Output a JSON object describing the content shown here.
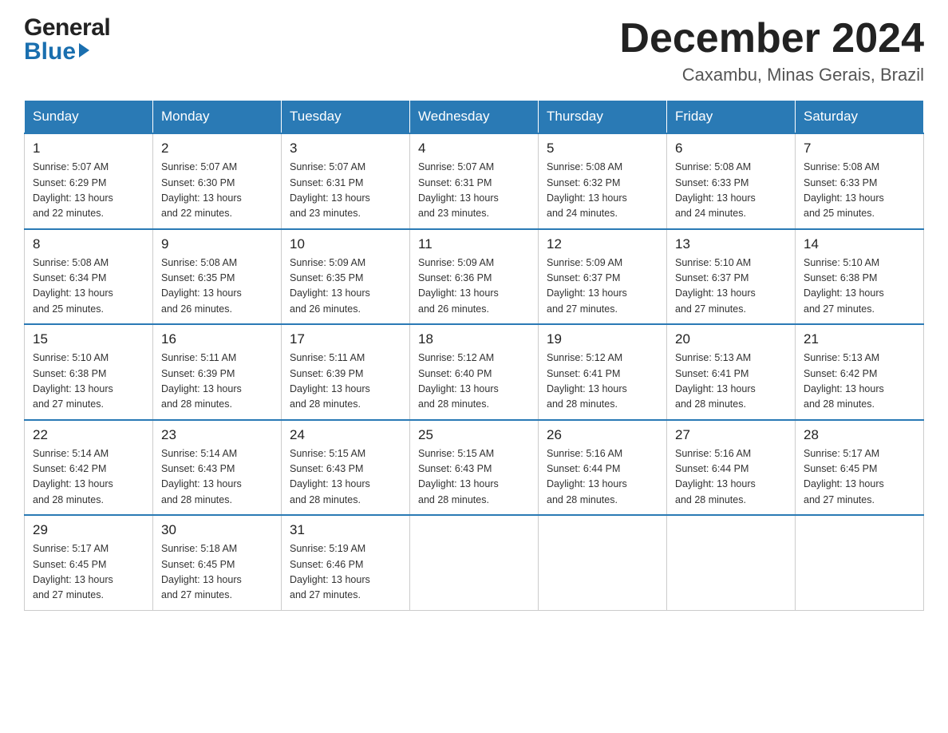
{
  "header": {
    "logo_general": "General",
    "logo_blue": "Blue",
    "month_title": "December 2024",
    "subtitle": "Caxambu, Minas Gerais, Brazil"
  },
  "days_of_week": [
    "Sunday",
    "Monday",
    "Tuesday",
    "Wednesday",
    "Thursday",
    "Friday",
    "Saturday"
  ],
  "weeks": [
    [
      {
        "day": "1",
        "sunrise": "5:07 AM",
        "sunset": "6:29 PM",
        "daylight": "13 hours and 22 minutes."
      },
      {
        "day": "2",
        "sunrise": "5:07 AM",
        "sunset": "6:30 PM",
        "daylight": "13 hours and 22 minutes."
      },
      {
        "day": "3",
        "sunrise": "5:07 AM",
        "sunset": "6:31 PM",
        "daylight": "13 hours and 23 minutes."
      },
      {
        "day": "4",
        "sunrise": "5:07 AM",
        "sunset": "6:31 PM",
        "daylight": "13 hours and 23 minutes."
      },
      {
        "day": "5",
        "sunrise": "5:08 AM",
        "sunset": "6:32 PM",
        "daylight": "13 hours and 24 minutes."
      },
      {
        "day": "6",
        "sunrise": "5:08 AM",
        "sunset": "6:33 PM",
        "daylight": "13 hours and 24 minutes."
      },
      {
        "day": "7",
        "sunrise": "5:08 AM",
        "sunset": "6:33 PM",
        "daylight": "13 hours and 25 minutes."
      }
    ],
    [
      {
        "day": "8",
        "sunrise": "5:08 AM",
        "sunset": "6:34 PM",
        "daylight": "13 hours and 25 minutes."
      },
      {
        "day": "9",
        "sunrise": "5:08 AM",
        "sunset": "6:35 PM",
        "daylight": "13 hours and 26 minutes."
      },
      {
        "day": "10",
        "sunrise": "5:09 AM",
        "sunset": "6:35 PM",
        "daylight": "13 hours and 26 minutes."
      },
      {
        "day": "11",
        "sunrise": "5:09 AM",
        "sunset": "6:36 PM",
        "daylight": "13 hours and 26 minutes."
      },
      {
        "day": "12",
        "sunrise": "5:09 AM",
        "sunset": "6:37 PM",
        "daylight": "13 hours and 27 minutes."
      },
      {
        "day": "13",
        "sunrise": "5:10 AM",
        "sunset": "6:37 PM",
        "daylight": "13 hours and 27 minutes."
      },
      {
        "day": "14",
        "sunrise": "5:10 AM",
        "sunset": "6:38 PM",
        "daylight": "13 hours and 27 minutes."
      }
    ],
    [
      {
        "day": "15",
        "sunrise": "5:10 AM",
        "sunset": "6:38 PM",
        "daylight": "13 hours and 27 minutes."
      },
      {
        "day": "16",
        "sunrise": "5:11 AM",
        "sunset": "6:39 PM",
        "daylight": "13 hours and 28 minutes."
      },
      {
        "day": "17",
        "sunrise": "5:11 AM",
        "sunset": "6:39 PM",
        "daylight": "13 hours and 28 minutes."
      },
      {
        "day": "18",
        "sunrise": "5:12 AM",
        "sunset": "6:40 PM",
        "daylight": "13 hours and 28 minutes."
      },
      {
        "day": "19",
        "sunrise": "5:12 AM",
        "sunset": "6:41 PM",
        "daylight": "13 hours and 28 minutes."
      },
      {
        "day": "20",
        "sunrise": "5:13 AM",
        "sunset": "6:41 PM",
        "daylight": "13 hours and 28 minutes."
      },
      {
        "day": "21",
        "sunrise": "5:13 AM",
        "sunset": "6:42 PM",
        "daylight": "13 hours and 28 minutes."
      }
    ],
    [
      {
        "day": "22",
        "sunrise": "5:14 AM",
        "sunset": "6:42 PM",
        "daylight": "13 hours and 28 minutes."
      },
      {
        "day": "23",
        "sunrise": "5:14 AM",
        "sunset": "6:43 PM",
        "daylight": "13 hours and 28 minutes."
      },
      {
        "day": "24",
        "sunrise": "5:15 AM",
        "sunset": "6:43 PM",
        "daylight": "13 hours and 28 minutes."
      },
      {
        "day": "25",
        "sunrise": "5:15 AM",
        "sunset": "6:43 PM",
        "daylight": "13 hours and 28 minutes."
      },
      {
        "day": "26",
        "sunrise": "5:16 AM",
        "sunset": "6:44 PM",
        "daylight": "13 hours and 28 minutes."
      },
      {
        "day": "27",
        "sunrise": "5:16 AM",
        "sunset": "6:44 PM",
        "daylight": "13 hours and 28 minutes."
      },
      {
        "day": "28",
        "sunrise": "5:17 AM",
        "sunset": "6:45 PM",
        "daylight": "13 hours and 27 minutes."
      }
    ],
    [
      {
        "day": "29",
        "sunrise": "5:17 AM",
        "sunset": "6:45 PM",
        "daylight": "13 hours and 27 minutes."
      },
      {
        "day": "30",
        "sunrise": "5:18 AM",
        "sunset": "6:45 PM",
        "daylight": "13 hours and 27 minutes."
      },
      {
        "day": "31",
        "sunrise": "5:19 AM",
        "sunset": "6:46 PM",
        "daylight": "13 hours and 27 minutes."
      },
      null,
      null,
      null,
      null
    ]
  ],
  "labels": {
    "sunrise": "Sunrise:",
    "sunset": "Sunset:",
    "daylight": "Daylight:"
  }
}
